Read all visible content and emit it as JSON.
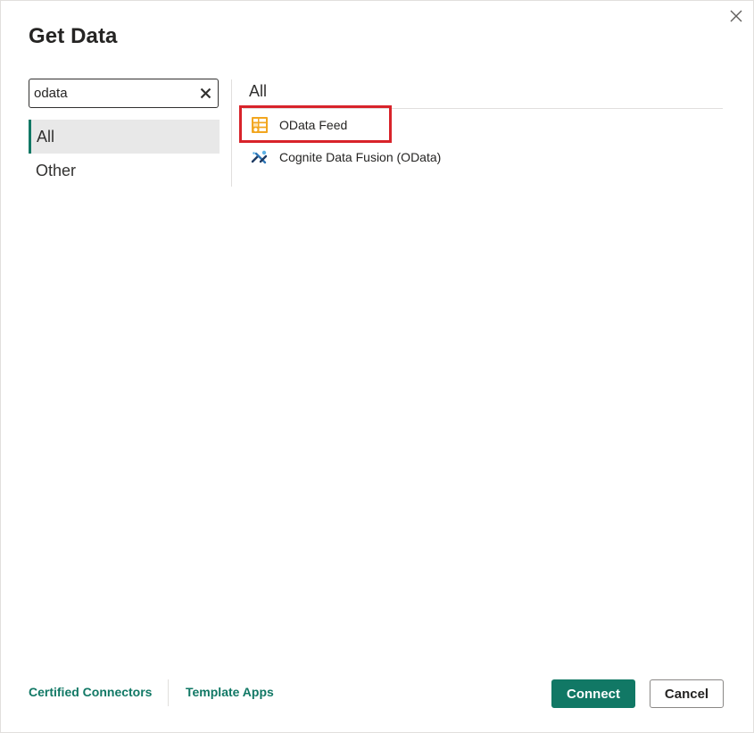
{
  "dialog": {
    "title": "Get Data",
    "close_icon": "close-icon"
  },
  "search": {
    "value": "odata",
    "placeholder": "Search",
    "clear_icon": "clear-icon"
  },
  "categories": [
    {
      "label": "All",
      "selected": true
    },
    {
      "label": "Other",
      "selected": false
    }
  ],
  "results": {
    "header": "All",
    "items": [
      {
        "label": "OData Feed",
        "icon": "odata-feed-icon",
        "highlighted": true
      },
      {
        "label": "Cognite Data Fusion (OData)",
        "icon": "cognite-icon",
        "highlighted": false
      }
    ]
  },
  "footer": {
    "certified_connectors": "Certified Connectors",
    "template_apps": "Template Apps",
    "connect_label": "Connect",
    "cancel_label": "Cancel"
  },
  "colors": {
    "accent": "#117865",
    "highlight_border": "#d8232a",
    "selected_bg": "#e8e8e8",
    "odata_icon": "#f2a61f"
  }
}
